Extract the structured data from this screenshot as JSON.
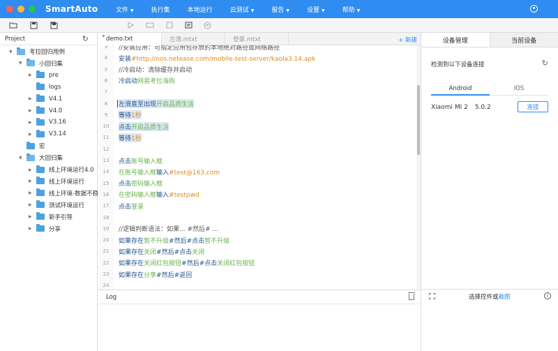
{
  "app": {
    "title": "SmartAuto"
  },
  "menu": [
    {
      "label": "文件",
      "caret": true
    },
    {
      "label": "执行集",
      "caret": false
    },
    {
      "label": "本地运行",
      "caret": false
    },
    {
      "label": "云测试",
      "caret": true
    },
    {
      "label": "报告",
      "caret": true
    },
    {
      "label": "设置",
      "caret": true
    },
    {
      "label": "帮助",
      "caret": true
    }
  ],
  "toolbar_icons": [
    "folder-icon",
    "save-icon",
    "save-all-icon",
    "play-icon",
    "play-step-icon",
    "stop-icon",
    "record-icon",
    "monitor-icon"
  ],
  "project": {
    "header": "Project",
    "tree": [
      {
        "label": "考拉回归用例",
        "level": 0,
        "expanded": true
      },
      {
        "label": "小回归集",
        "level": 1,
        "expanded": true
      },
      {
        "label": "pre",
        "level": 2,
        "expanded": false
      },
      {
        "label": "logs",
        "level": 2,
        "expanded": null
      },
      {
        "label": "V4.1",
        "level": 2,
        "expanded": false
      },
      {
        "label": "V4.0",
        "level": 2,
        "expanded": false
      },
      {
        "label": "V3.16",
        "level": 2,
        "expanded": false
      },
      {
        "label": "V3.14",
        "level": 2,
        "expanded": false
      },
      {
        "label": "宏",
        "level": 1,
        "expanded": null
      },
      {
        "label": "大回归集",
        "level": 1,
        "expanded": true
      },
      {
        "label": "线上环境运行4.0",
        "level": 2,
        "expanded": false
      },
      {
        "label": "线上环境运行",
        "level": 2,
        "expanded": false
      },
      {
        "label": "线上环境-数据不稳",
        "level": 2,
        "expanded": false
      },
      {
        "label": "测试环境运行",
        "level": 2,
        "expanded": false
      },
      {
        "label": "新手引导",
        "level": 2,
        "expanded": false
      },
      {
        "label": "分享",
        "level": 2,
        "expanded": false
      }
    ]
  },
  "editor": {
    "tabs": [
      "demo.txt",
      "左滑.mtxt",
      "登录.mtxt"
    ],
    "active_tab": 0,
    "new_label": "+ 新建",
    "lines": [
      {
        "n": "3",
        "hl": false,
        "parts": [
          [
            "cm",
            "//安装应用：可指定应用包存放的本地绝对路径或网络路径"
          ]
        ]
      },
      {
        "n": "4",
        "hl": false,
        "parts": [
          [
            "kw",
            "安装"
          ],
          [
            "str",
            "#http://nos.netease.com/mobile-test-server/kaola3.14.apk"
          ]
        ]
      },
      {
        "n": "5",
        "hl": false,
        "parts": [
          [
            "cm",
            "//冷启动：清除缓存并启动"
          ]
        ]
      },
      {
        "n": "6",
        "hl": false,
        "parts": [
          [
            "kw",
            "冷启动"
          ],
          [
            "el",
            "网易考拉海购"
          ]
        ]
      },
      {
        "n": "7",
        "hl": false,
        "parts": []
      },
      {
        "n": "8",
        "hl": true,
        "parts": [
          [
            "kw",
            "左滑直至出现"
          ],
          [
            "el",
            "开启品质生活"
          ]
        ]
      },
      {
        "n": "9",
        "hl": true,
        "parts": [
          [
            "kw",
            "等待"
          ],
          [
            "str",
            "1秒"
          ]
        ]
      },
      {
        "n": "10",
        "hl": true,
        "parts": [
          [
            "kw",
            "点击"
          ],
          [
            "el",
            "开启品质生活"
          ]
        ]
      },
      {
        "n": "11",
        "hl": true,
        "parts": [
          [
            "kw",
            "等待"
          ],
          [
            "str",
            "1秒"
          ]
        ]
      },
      {
        "n": "12",
        "hl": false,
        "parts": []
      },
      {
        "n": "13",
        "hl": false,
        "parts": [
          [
            "kw",
            "点击"
          ],
          [
            "el",
            "账号输入框"
          ]
        ]
      },
      {
        "n": "14",
        "hl": false,
        "parts": [
          [
            "el",
            "在账号输入框"
          ],
          [
            "kw",
            "输入"
          ],
          [
            "str",
            "#test@163.com"
          ]
        ]
      },
      {
        "n": "15",
        "hl": false,
        "parts": [
          [
            "kw",
            "点击"
          ],
          [
            "el",
            "密码输入框"
          ]
        ]
      },
      {
        "n": "16",
        "hl": false,
        "parts": [
          [
            "el",
            "在密码输入框"
          ],
          [
            "kw",
            "输入"
          ],
          [
            "str",
            "#testpwd"
          ]
        ]
      },
      {
        "n": "17",
        "hl": false,
        "parts": [
          [
            "kw",
            "点击"
          ],
          [
            "el",
            "登录"
          ]
        ]
      },
      {
        "n": "18",
        "hl": false,
        "parts": []
      },
      {
        "n": "19",
        "hl": false,
        "parts": [
          [
            "cm",
            "//逻辑判断语法：如果... #然后# ..."
          ]
        ]
      },
      {
        "n": "20",
        "hl": false,
        "parts": [
          [
            "kw",
            "如果存在"
          ],
          [
            "el",
            "暂不升级"
          ],
          [
            "kw",
            "#然后#点击"
          ],
          [
            "el",
            "暂不升级"
          ]
        ]
      },
      {
        "n": "21",
        "hl": false,
        "parts": [
          [
            "kw",
            "如果存在"
          ],
          [
            "el",
            "关闭"
          ],
          [
            "kw",
            "#然后#点击"
          ],
          [
            "el",
            "关闭"
          ]
        ]
      },
      {
        "n": "22",
        "hl": false,
        "parts": [
          [
            "kw",
            "如果存在"
          ],
          [
            "el",
            "关闭红包按钮"
          ],
          [
            "kw",
            "#然后#点击"
          ],
          [
            "el",
            "关闭红包按钮"
          ]
        ]
      },
      {
        "n": "23",
        "hl": false,
        "parts": [
          [
            "kw",
            "如果存在"
          ],
          [
            "el",
            "分享"
          ],
          [
            "kw",
            "#然后#返回"
          ]
        ]
      },
      {
        "n": "24",
        "hl": false,
        "parts": []
      }
    ]
  },
  "log": {
    "title": "Log"
  },
  "devices": {
    "tabs": [
      "设备管理",
      "当前设备"
    ],
    "detect_text": "检测到以下设备连接",
    "os_tabs": [
      "Android",
      "IOS"
    ],
    "device_name": "Xiaomi MI 2",
    "device_version": "5.0.2",
    "connect_label": "连接",
    "footer_text": "选择控件或",
    "footer_link": "截图"
  },
  "colors": {
    "accent": "#2f8cf0",
    "keyword": "#1f4f8b",
    "string": "#e0891f",
    "element": "#69b34c"
  }
}
